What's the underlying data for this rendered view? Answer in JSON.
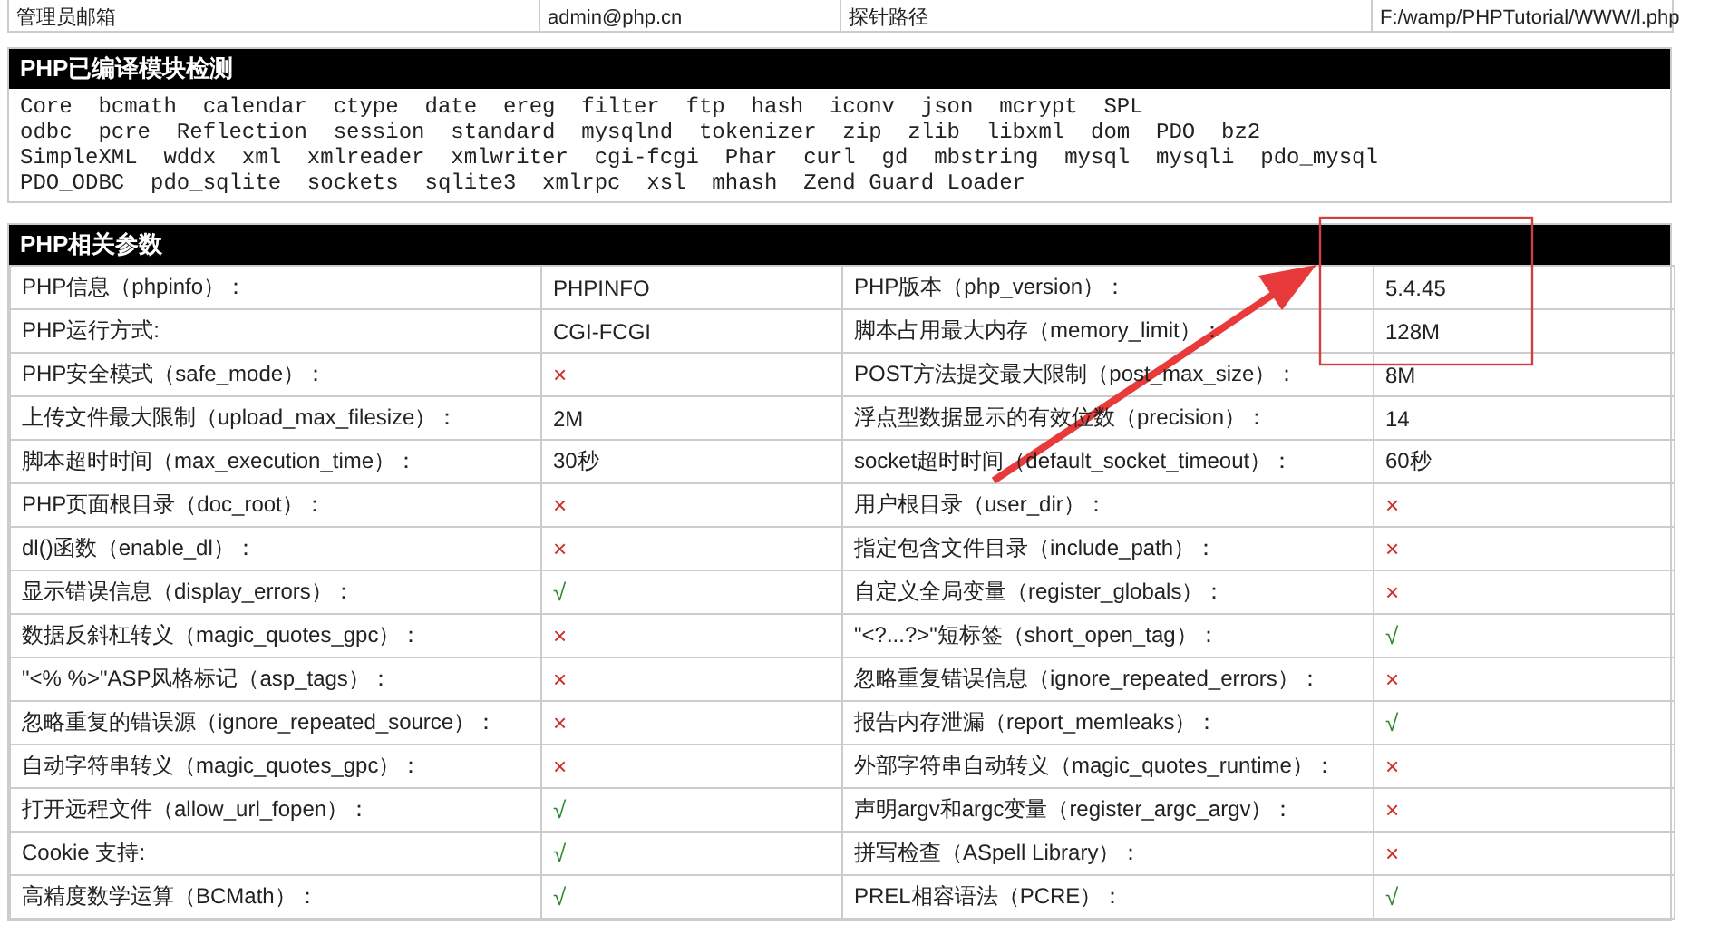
{
  "top_row": {
    "cells": [
      "管理员邮箱",
      "admin@php.cn",
      "探针路径",
      "F:/wamp/PHPTutorial/WWW/l.php"
    ]
  },
  "modules": {
    "title": "PHP已编译模块检测",
    "lines": [
      "Core  bcmath  calendar  ctype  date  ereg  filter  ftp  hash  iconv  json  mcrypt  SPL",
      "odbc  pcre  Reflection  session  standard  mysqlnd  tokenizer  zip  zlib  libxml  dom  PDO  bz2",
      "SimpleXML  wddx  xml  xmlreader  xmlwriter  cgi-fcgi  Phar  curl  gd  mbstring  mysql  mysqli  pdo_mysql",
      "PDO_ODBC  pdo_sqlite  sockets  sqlite3  xmlrpc  xsl  mhash  Zend Guard Loader"
    ]
  },
  "params": {
    "title": "PHP相关参数",
    "rows": [
      {
        "label": "PHP信息（phpinfo）：",
        "value": "PHPINFO",
        "label_2": "PHP版本（php_version）：",
        "value_2": "5.4.45"
      },
      {
        "label": "PHP运行方式:",
        "value": "CGI-FCGI",
        "label_2": "脚本占用最大内存（memory_limit）：",
        "value_2": "128M"
      },
      {
        "label": "PHP安全模式（safe_mode）：",
        "value": "×",
        "ok": false,
        "label_2": "POST方法提交最大限制（post_max_size）：",
        "value_2": "8M"
      },
      {
        "label": "上传文件最大限制（upload_max_filesize）：",
        "value": "2M",
        "label_2": "浮点型数据显示的有效位数（precision）：",
        "value_2": "14"
      },
      {
        "label": "脚本超时时间（max_execution_time）：",
        "value": "30秒",
        "label_2": "socket超时时间（default_socket_timeout）：",
        "value_2": "60秒"
      },
      {
        "label": "PHP页面根目录（doc_root）：",
        "value": "×",
        "ok": false,
        "label_2": "用户根目录（user_dir）：",
        "value_2": "×",
        "ok_2": false
      },
      {
        "label": "dl()函数（enable_dl）：",
        "value": "×",
        "ok": false,
        "label_2": "指定包含文件目录（include_path）：",
        "value_2": "×",
        "ok_2": false
      },
      {
        "label": "显示错误信息（display_errors）：",
        "value": "√",
        "ok": true,
        "label_2": "自定义全局变量（register_globals）：",
        "value_2": "×",
        "ok_2": false
      },
      {
        "label": "数据反斜杠转义（magic_quotes_gpc）：",
        "value": "×",
        "ok": false,
        "label_2": "\"<?...?>\"短标签（short_open_tag）：",
        "value_2": "√",
        "ok_2": true
      },
      {
        "label": "\"<% %>\"ASP风格标记（asp_tags）：",
        "value": "×",
        "ok": false,
        "label_2": "忽略重复错误信息（ignore_repeated_errors）：",
        "value_2": "×",
        "ok_2": false
      },
      {
        "label": "忽略重复的错误源（ignore_repeated_source）：",
        "value": "×",
        "ok": false,
        "label_2": "报告内存泄漏（report_memleaks）：",
        "value_2": "√",
        "ok_2": true
      },
      {
        "label": "自动字符串转义（magic_quotes_gpc）：",
        "value": "×",
        "ok": false,
        "label_2": "外部字符串自动转义（magic_quotes_runtime）：",
        "value_2": "×",
        "ok_2": false
      },
      {
        "label": "打开远程文件（allow_url_fopen）：",
        "value": "√",
        "ok": true,
        "label_2": "声明argv和argc变量（register_argc_argv）：",
        "value_2": "×",
        "ok_2": false
      },
      {
        "label": "Cookie 支持:",
        "value": "√",
        "ok": true,
        "label_2": "拼写检查（ASpell Library）：",
        "value_2": "×",
        "ok_2": false
      },
      {
        "label": "高精度数学运算（BCMath）：",
        "value": "√",
        "ok": true,
        "label_2": "PREL相容语法（PCRE）：",
        "value_2": "√",
        "ok_2": true
      }
    ]
  }
}
